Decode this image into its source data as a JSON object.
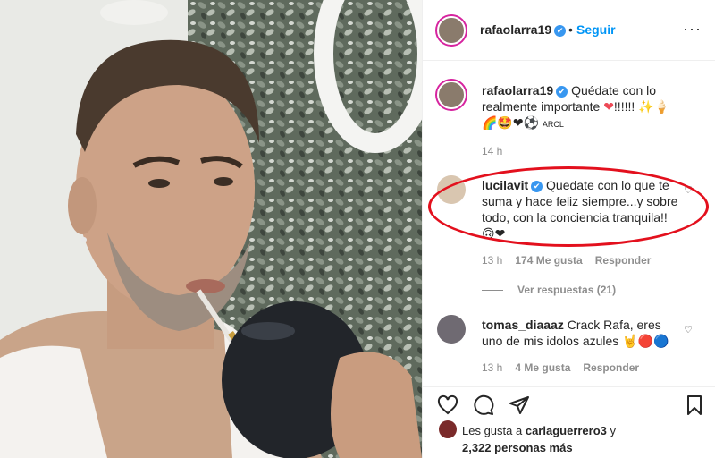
{
  "post": {
    "username": "rafaolarra19",
    "verified_mark": "✔",
    "separator": "•",
    "follow_label": "Seguir",
    "more_label": "···"
  },
  "caption": {
    "username": "rafaolarra19",
    "text": "Quédate con lo realmente importante",
    "exclaims": "!!!!!!",
    "emoji_line1_tail": "✨🍦",
    "emoji_line2": "🌈🤩❤⚽",
    "tag": "ARCL",
    "time": "14 h"
  },
  "comments": [
    {
      "username": "lucilavit",
      "text": "Quedate con lo que te suma y hace feliz siempre...y sobre todo, con la conciencia tranquila!!",
      "emoji": "🙃❤",
      "time": "13 h",
      "likes": "174 Me gusta",
      "reply": "Responder",
      "view_replies": "Ver respuestas (21)"
    },
    {
      "username": "tomas_diaaaz",
      "text": "Crack Rafa, eres uno de mis idolos azules",
      "emoji": "🤘🔴🔵",
      "time": "13 h",
      "likes": "4 Me gusta",
      "reply": "Responder"
    }
  ],
  "likes": {
    "prefix": "Les gusta a",
    "user": "carlaguerrero3",
    "joiner": "y",
    "count": "2,322 personas más"
  },
  "icons": {
    "like": "heart-outline-icon",
    "comment": "comment-bubble-icon",
    "share": "paper-plane-icon",
    "save": "bookmark-icon",
    "small_like": "small-heart-icon"
  },
  "colors": {
    "link_blue": "#0095f6",
    "verified_blue": "#3897f0",
    "annotation_red": "#e3101d",
    "muted": "#8e8e8e"
  }
}
